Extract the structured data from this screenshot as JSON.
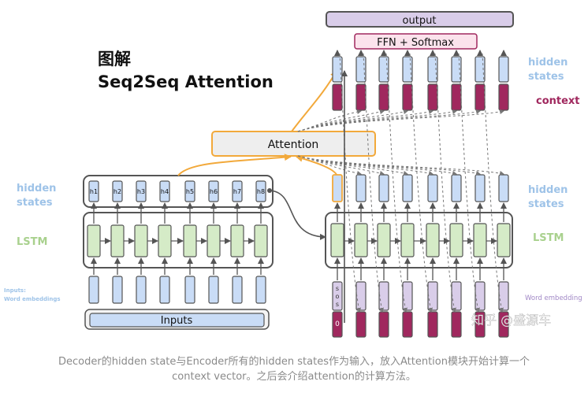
{
  "title": {
    "line1": "图解",
    "line2": "Seq2Seq Attention"
  },
  "encoder": {
    "hidden_labels": [
      "h1",
      "h2",
      "h3",
      "h4",
      "h5",
      "h6",
      "h7",
      "h8"
    ],
    "hidden_states_label_1": "hidden",
    "hidden_states_label_2": "states",
    "lstm_label": "LSTM",
    "inputs_label_1": "Inputs:",
    "inputs_label_2": "Word embeddings",
    "inputs_bar_label": "Inputs"
  },
  "attention": {
    "label": "Attention"
  },
  "decoder": {
    "output_label": "output",
    "ffn_label": "FFN + Softmax",
    "hidden_states_label_1": "hidden",
    "hidden_states_label_2": "states",
    "context_label": "context",
    "lstm_label": "LSTM",
    "word_embedding_label": "Word embedding",
    "sos_letters": [
      "s",
      "o",
      "s"
    ],
    "zero_label": "0"
  },
  "watermark": "知乎 @盛源车",
  "caption": {
    "line1": "Decoder的hidden state与Encoder所有的hidden states作为输入，放入Attention模块开始计算一个",
    "line2": "context vector。之后会介绍attention的计算方法。"
  },
  "colors": {
    "hidden_blue": "#c9dcf6",
    "lstm_green": "#d5ebc7",
    "context_maroon": "#a0285e",
    "embed_purple": "#d9cde9",
    "attention_orange": "#f2a93b",
    "label_blue": "#9ec3e8",
    "label_green": "#a9d18e",
    "label_maroon": "#a0285e"
  }
}
